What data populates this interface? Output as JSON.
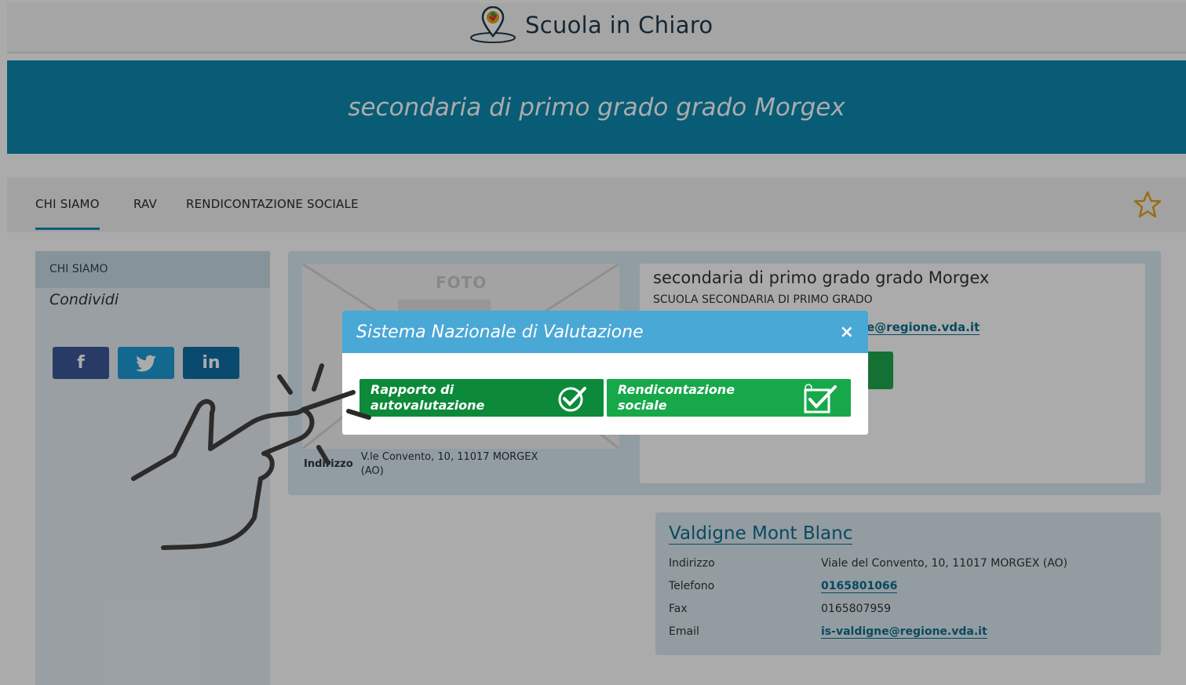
{
  "header": {
    "app_name": "Scuola in Chiaro"
  },
  "banner": {
    "title": "secondaria di primo grado grado Morgex"
  },
  "tabs": [
    {
      "label": "CHI SIAMO",
      "active": true
    },
    {
      "label": "RAV",
      "active": false
    },
    {
      "label": "RENDICONTAZIONE SOCIALE",
      "active": false
    }
  ],
  "sidebar": {
    "heading": "CHI SIAMO",
    "share_label": "Condividi",
    "social": [
      {
        "name": "facebook",
        "glyph": "f",
        "color": "#3b5998"
      },
      {
        "name": "twitter",
        "glyph": "t",
        "color": "#1d9bd6"
      },
      {
        "name": "linkedin",
        "glyph": "in",
        "color": "#0f6fa6"
      }
    ]
  },
  "school": {
    "photo_label": "FOTO",
    "name": "secondaria di primo grado grado Morgex",
    "type": "SCUOLA SECONDARIA DI PRIMO GRADO",
    "email_partial": "e@regione.vda.it",
    "address_label": "Indirizzo",
    "address_value": "V.le Convento, 10, 11017 MORGEX (AO)"
  },
  "institute": {
    "name": "Valdigne Mont Blanc",
    "rows": [
      {
        "key": "Indirizzo",
        "value": "Viale del Convento, 10, 11017 MORGEX (AO)",
        "link": false
      },
      {
        "key": "Telefono",
        "value": "0165801066",
        "link": true
      },
      {
        "key": "Fax",
        "value": "0165807959",
        "link": false
      },
      {
        "key": "Email",
        "value": "is-valdigne@regione.vda.it",
        "link": true
      }
    ]
  },
  "modal": {
    "title": "Sistema Nazionale di Valutazione",
    "close_glyph": "×",
    "buttons": [
      {
        "line1": "Rapporto di",
        "line2": "autovalutazione"
      },
      {
        "line1": "Rendicontazione",
        "line2": "sociale"
      }
    ]
  },
  "colors": {
    "brand": "#0c8aaf",
    "modal_header": "#4aa8d6",
    "button_dark_green": "#0c8a3a",
    "button_green": "#17a84a"
  }
}
